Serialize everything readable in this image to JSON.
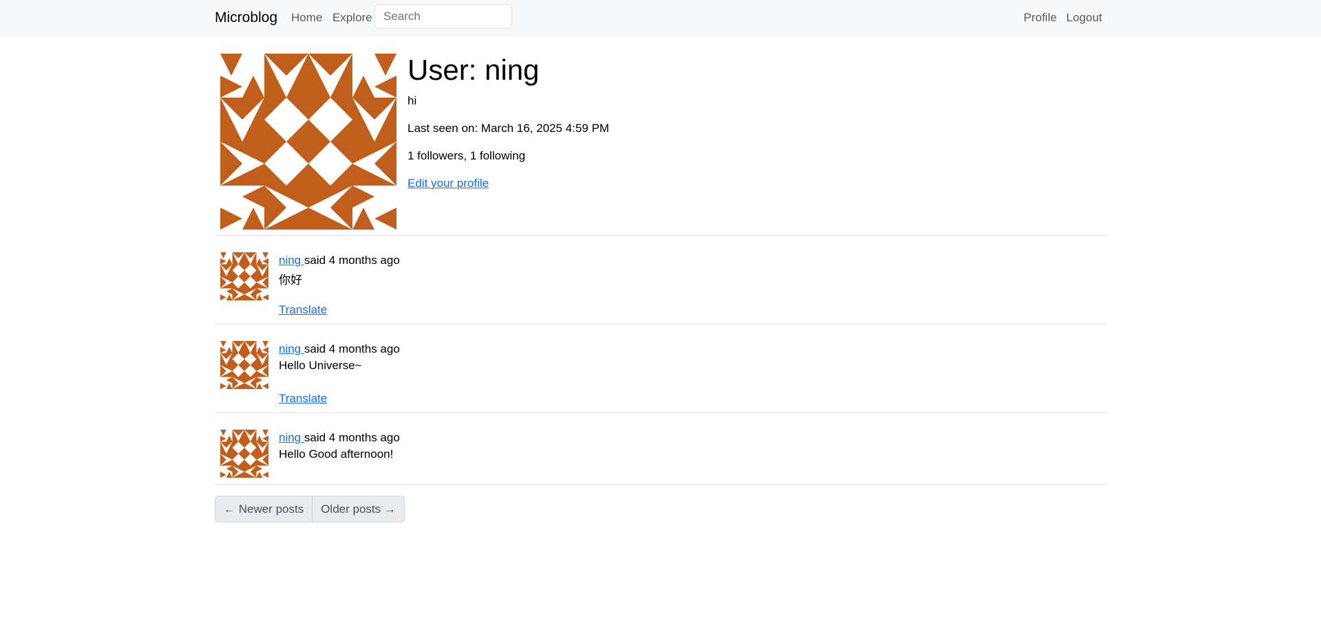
{
  "navbar": {
    "brand": "Microblog",
    "links": [
      "Home",
      "Explore"
    ],
    "search_placeholder": "Search",
    "right_links": [
      "Profile",
      "Logout"
    ]
  },
  "profile": {
    "title": "User: ning",
    "about": "hi",
    "last_seen": "Last seen on: March 16, 2025 4:59 PM",
    "follow_counts": "1 followers, 1 following",
    "edit_link": "Edit your profile"
  },
  "posts": [
    {
      "author": "ning ",
      "meta": "said 4 months ago",
      "body": "你好",
      "translate": "Translate"
    },
    {
      "author": "ning ",
      "meta": "said 4 months ago",
      "body": "Hello Universe~",
      "translate": "Translate"
    },
    {
      "author": "ning ",
      "meta": "said 4 months ago",
      "body": "Hello Good afternoon!"
    }
  ],
  "pagination": {
    "newer": "← Newer posts",
    "older": "Older posts →"
  },
  "colors": {
    "avatar": "#c25e1c",
    "link": "#0d6efd",
    "navbar_bg": "#f8f9fa"
  },
  "icons": {
    "avatar": "identicon-avatar"
  }
}
